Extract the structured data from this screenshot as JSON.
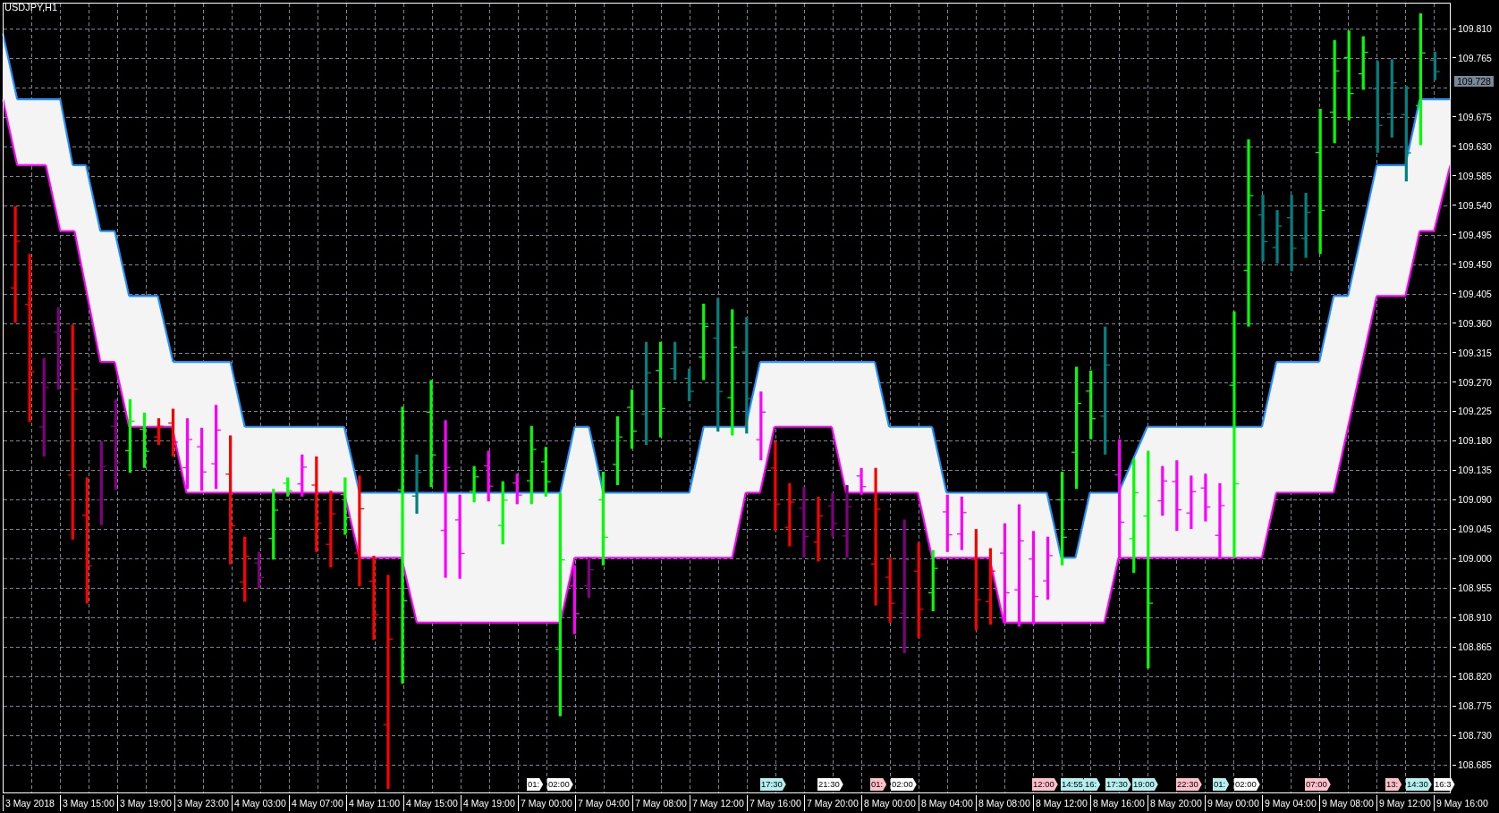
{
  "chart": {
    "title": "USDJPY,H1"
  },
  "price_axis": {
    "ticks": [
      "109.810",
      "109.765",
      "109.675",
      "109.630",
      "109.585",
      "109.540",
      "109.495",
      "109.450",
      "109.405",
      "109.360",
      "109.315",
      "109.270",
      "109.225",
      "109.180",
      "109.135",
      "109.090",
      "109.045",
      "109.000",
      "108.955",
      "108.910",
      "108.865",
      "108.820",
      "108.775",
      "108.730",
      "108.685"
    ],
    "current_price": "109.728"
  },
  "time_axis": {
    "labels": [
      "3 May 2018",
      "3 May 15:00",
      "3 May 19:00",
      "3 May 23:00",
      "4 May 03:00",
      "4 May 07:00",
      "4 May 11:00",
      "4 May 15:00",
      "4 May 19:00",
      "7 May 00:00",
      "7 May 04:00",
      "7 May 08:00",
      "7 May 12:00",
      "7 May 16:00",
      "7 May 20:00",
      "8 May 00:00",
      "8 May 04:00",
      "8 May 08:00",
      "8 May 12:00",
      "8 May 16:00",
      "8 May 20:00",
      "9 May 00:00",
      "9 May 04:00",
      "9 May 08:00",
      "9 May 12:00",
      "9 May 16:00"
    ]
  },
  "event_markers": [
    {
      "text": "01:",
      "color": "#ffffff"
    },
    {
      "text": "02:00",
      "color": "#ffffff"
    },
    {
      "text": "17:30",
      "color": "#b4f0f0"
    },
    {
      "text": "21:30",
      "color": "#ffffff"
    },
    {
      "text": "01:",
      "color": "#ffc0cb"
    },
    {
      "text": "02:00",
      "color": "#ffffff"
    },
    {
      "text": "12:00",
      "color": "#ffc0cb"
    },
    {
      "text": "14:55",
      "color": "#b4f0f0"
    },
    {
      "text": "16:",
      "color": "#b4f0f0"
    },
    {
      "text": "17:30",
      "color": "#b4f0f0"
    },
    {
      "text": "19:00",
      "color": "#b4f0f0"
    },
    {
      "text": "22:30",
      "color": "#ffc0cb"
    },
    {
      "text": "01:",
      "color": "#b4f0f0"
    },
    {
      "text": "02:00",
      "color": "#ffffff"
    },
    {
      "text": "07:00",
      "color": "#ffc0cb"
    },
    {
      "text": "13:",
      "color": "#ffc0cb"
    },
    {
      "text": "14:30",
      "color": "#b4f0f0"
    },
    {
      "text": "16:3",
      "color": "#ffffff"
    }
  ]
}
